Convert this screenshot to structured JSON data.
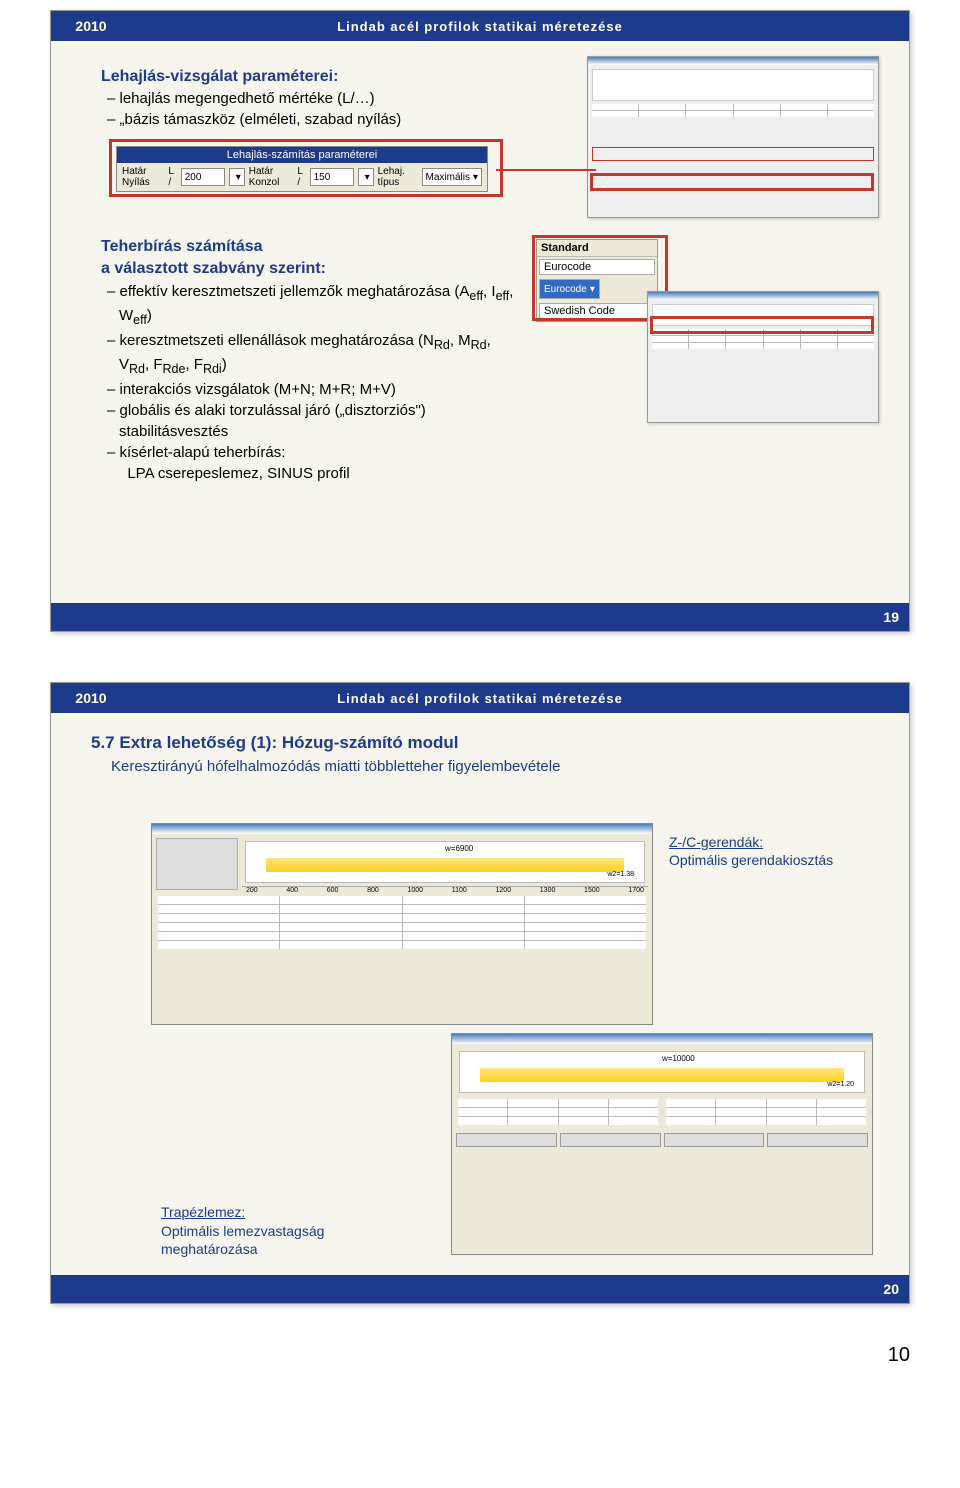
{
  "header": {
    "year": "2010",
    "title": "Lindab acél profilok statikai méretezése"
  },
  "slide19": {
    "section1": {
      "title": "Lehajlás-vizsgálat paraméterei:",
      "items": [
        "– lehajlás megengedhető mértéke (L/…)",
        "– „bázis támaszköz (elméleti, szabad nyílás)"
      ]
    },
    "panel": {
      "caption": "Lehajlás-számítás paraméterei",
      "labels": {
        "hatar_nyilas": "Határ Nyílás",
        "l1": "L /",
        "val1": "200",
        "hatar_konzol": "Határ Konzol",
        "l2": "L /",
        "val2": "150",
        "lehaj_tipus": "Lehaj. típus",
        "maximalis": "Maximális"
      }
    },
    "section2": {
      "title": "Teherbírás számítása",
      "subtitle": "a választott szabvány szerint:",
      "items": [
        "– effektív keresztmetszeti jellemzők meghatározása (Aeff, Ieff, Weff)",
        "– keresztmetszeti ellenállások meghatározása (NRd, MRd, VRd, FRde, FRdi)",
        "– interakciós vizsgálatok (M+N; M+R; M+V)",
        "– globális és alaki torzulással járó („disztorziós\") stabilitásvesztés",
        "– kísérlet-alapú teherbírás:",
        "  LPA cserepeslemez, SINUS profil"
      ]
    },
    "standard_panel": {
      "header": "Standard",
      "default": "Eurocode",
      "options": [
        "Eurocode",
        "Swedish Code"
      ]
    },
    "num": "19"
  },
  "slide20": {
    "section_title": "5.7 Extra lehetőség (1): Hózug-számító modul",
    "subtitle": "Keresztirányú hófelhalmozódás miatti többletteher figyelembevétele",
    "annotation_right": {
      "line1": "Z-/C-gerendák:",
      "line2": "Optimális gerendakiosztás"
    },
    "annotation_left": {
      "line1": "Trapézlemez:",
      "line2": "Optimális lemezvastagság meghatározása"
    },
    "chart1": {
      "width_label": "w=6900",
      "step": "w2=1.38"
    },
    "chart2": {
      "width_label": "w=10000",
      "step": "w2=1.20"
    },
    "ruler_vals": [
      "200",
      "400",
      "600",
      "800",
      "1000",
      "1100",
      "1200",
      "1300",
      "1500",
      "1700"
    ],
    "num": "20"
  },
  "pagenum": "10"
}
